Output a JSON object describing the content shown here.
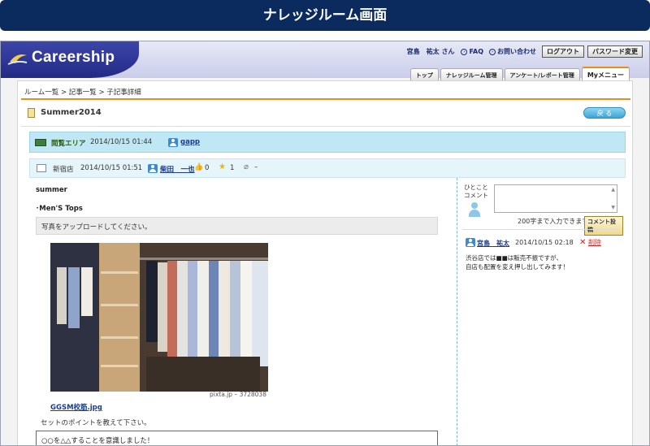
{
  "banner": {
    "title": "ナレッジルーム画面"
  },
  "app": {
    "logo_text": "Careership"
  },
  "topnav": {
    "username": "宮島　祐太 さん",
    "faq": "FAQ",
    "contact": "お問い合わせ",
    "logout": "ログアウト",
    "change_password": "パスワード変更"
  },
  "tabs": [
    {
      "label": "トップ"
    },
    {
      "label": "ナレッジルーム管理"
    },
    {
      "label": "アンケート/レポート管理"
    },
    {
      "label": "Myメニュー"
    }
  ],
  "breadcrumb": "ルーム一覧 > 記事一覧 > 子記事詳細",
  "page": {
    "title": "Summer2014",
    "back_label": "戻 る"
  },
  "room": {
    "label": "閲覧エリア",
    "date": "2014/10/15 01:44",
    "user": "gapp"
  },
  "post": {
    "shop": "新宿店",
    "date": "2014/10/15 01:51",
    "user": "柴田　一也",
    "likes": "0",
    "stars": "1",
    "attachments": "–"
  },
  "article": {
    "title": "summer",
    "subtitle": "･Men'S Tops",
    "upload_prompt": "写真をアップロードしてください。",
    "photo_caption": "pixta.jp – 3728038",
    "file_name": "GGSM校筋.jpg",
    "instruction": "セットのポイントを教えて下さい。",
    "answer": "○○を△△することを意識しました！"
  },
  "comments": {
    "label": "ひとこと\nコメント",
    "limit_text": "200字まで入力できます",
    "post_button": "コメント投稿",
    "items": [
      {
        "user": "宮島　祐太",
        "date": "2014/10/15 02:18",
        "delete_label": "削除",
        "body_line1": "渋谷店では■■は販売不振ですが、",
        "body_line2": "自店も配置を変え押し出してみます！"
      }
    ]
  }
}
